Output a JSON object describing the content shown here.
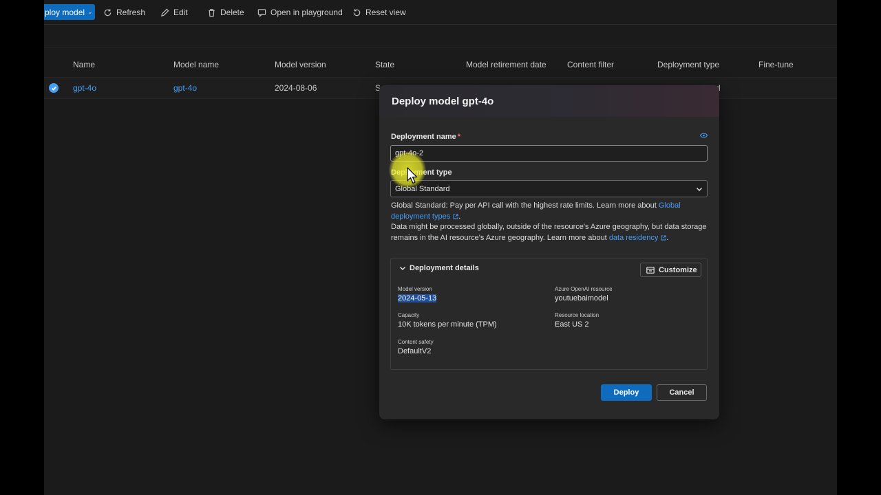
{
  "toolbar": {
    "deploy_label": "ploy model",
    "refresh_label": "Refresh",
    "edit_label": "Edit",
    "delete_label": "Delete",
    "playground_label": "Open in playground",
    "reset_label": "Reset view"
  },
  "table": {
    "headers": [
      "Name",
      "Model name",
      "Model version",
      "State",
      "Model retirement date",
      "Content filter",
      "Deployment type",
      "Fine-tune"
    ],
    "row": {
      "name": "gpt-4o",
      "model_name": "gpt-4o",
      "model_version": "2024-08-06",
      "state": "S",
      "deployment_type": "rd"
    }
  },
  "dialog": {
    "title": "Deploy model gpt-4o",
    "deployment_name_label": "Deployment name",
    "required_mark": "*",
    "deployment_name_value": "gpt-4o-2",
    "deployment_type_label": "Deployment type",
    "deployment_type_value": "Global Standard",
    "info_line1": "Global Standard: Pay per API call with the highest rate limits. Learn more about",
    "info_link1": "Global deployment types",
    "info_line2": "Data might be processed globally, outside of the resource's Azure geography, but data storage remains in the AI resource's Azure geography. Learn more about",
    "info_link2": "data residency",
    "details": {
      "header": "Deployment details",
      "customize_label": "Customize",
      "model_version_key": "Model version",
      "model_version_value": "2024-05-13",
      "openai_resource_key": "Azure OpenAI resource",
      "openai_resource_value": "youtuebaimodel",
      "capacity_key": "Capacity",
      "capacity_value": "10K tokens per minute (TPM)",
      "location_key": "Resource location",
      "location_value": "East US 2",
      "content_safety_key": "Content safety",
      "content_safety_value": "DefaultV2"
    },
    "deploy_button": "Deploy",
    "cancel_button": "Cancel"
  },
  "colors": {
    "accent": "#0f6cbd",
    "link": "#479ef5",
    "background": "#1b1b1b",
    "dialog": "#292929"
  }
}
